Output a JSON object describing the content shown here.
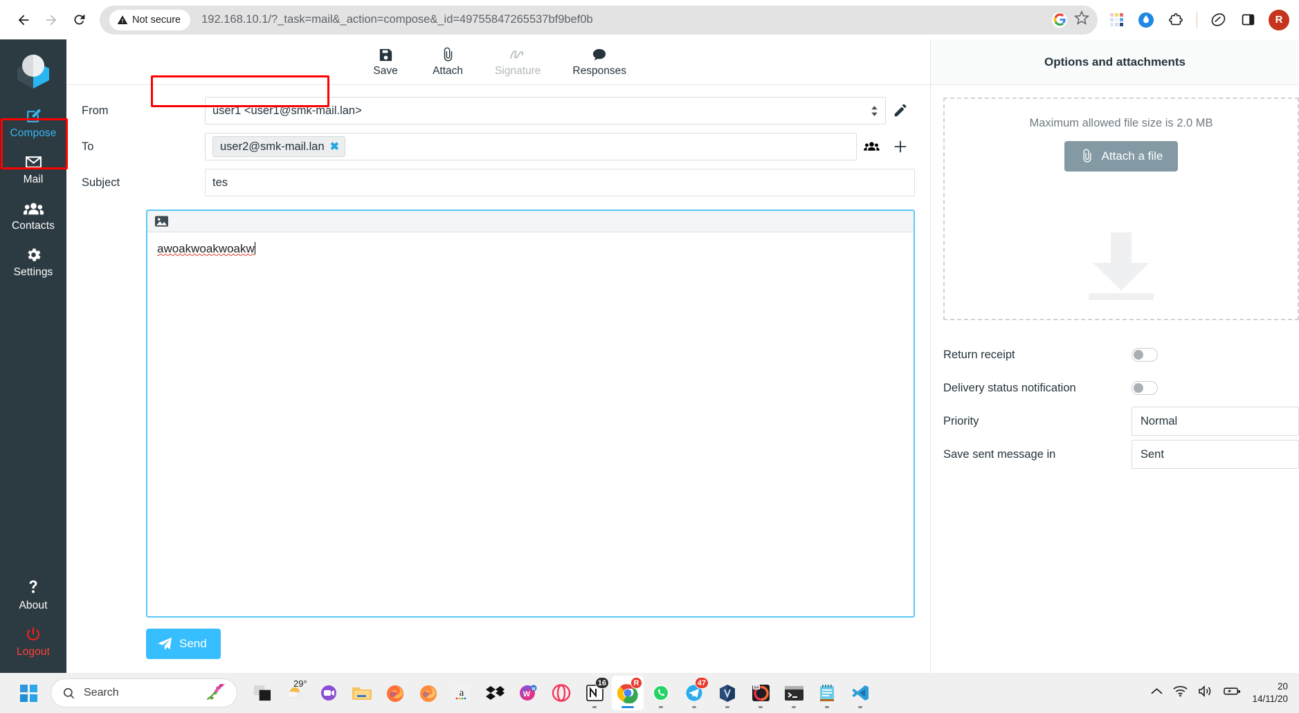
{
  "browser": {
    "back_label": "Back",
    "forward_label": "Forward",
    "reload_label": "Reload",
    "security_label": "Not secure",
    "url": "192.168.10.1/?_task=mail&_action=compose&_id=49755847265537bf9bef0b",
    "search_engine_icon": "google-g-icon",
    "bookmark_icon": "star-icon",
    "extensions": [
      "color-grid-extension-icon",
      "water-drop-extension-icon",
      "extensions-puzzle-icon",
      "leaf-extension-icon",
      "side-panel-icon"
    ],
    "profile_initial": "R"
  },
  "sidebar": {
    "logo": "roundcube-logo",
    "items": [
      {
        "label": "Compose",
        "icon": "compose-pencil-icon",
        "active": true
      },
      {
        "label": "Mail",
        "icon": "envelope-icon",
        "active": false
      },
      {
        "label": "Contacts",
        "icon": "people-icon",
        "active": false
      },
      {
        "label": "Settings",
        "icon": "gear-icon",
        "active": false
      }
    ],
    "bottom_items": [
      {
        "label": "About",
        "icon": "question-mark-icon"
      },
      {
        "label": "Logout",
        "icon": "power-icon"
      }
    ]
  },
  "toolbar": {
    "save": "Save",
    "attach": "Attach",
    "signature": "Signature",
    "responses": "Responses"
  },
  "compose": {
    "from_label": "From",
    "from_value": "user1 <user1@smk-mail.lan>",
    "to_label": "To",
    "to_chip": "user2@smk-mail.lan",
    "to_chip_remove": "✖",
    "subject_label": "Subject",
    "subject_value": "tes",
    "body_text": "awoakwoakwoakw",
    "send_label": "Send",
    "edit_identity_icon": "pencil-icon",
    "contacts_icon": "address-book-icon",
    "add_recipient_icon": "plus-icon",
    "insert_image_icon": "image-icon"
  },
  "options": {
    "title": "Options and attachments",
    "max_size_note": "Maximum allowed file size is 2.0 MB",
    "attach_button": "Attach a file",
    "rows": [
      {
        "label": "Return receipt",
        "type": "toggle",
        "value": "off"
      },
      {
        "label": "Delivery status notification",
        "type": "toggle",
        "value": "off"
      },
      {
        "label": "Priority",
        "type": "select",
        "value": "Normal"
      },
      {
        "label": "Save sent message in",
        "type": "select",
        "value": "Sent"
      }
    ]
  },
  "taskbar": {
    "start_label": "Start",
    "search_placeholder": "Search",
    "weather_temp": "29°",
    "apps": [
      {
        "name": "task-view",
        "badge": "",
        "active": false
      },
      {
        "name": "weather",
        "badge": "",
        "active": false
      },
      {
        "name": "teams",
        "badge": "",
        "active": false
      },
      {
        "name": "file-explorer",
        "badge": "",
        "active": false
      },
      {
        "name": "firefox",
        "badge": "",
        "active": false
      },
      {
        "name": "firefox-dev",
        "badge": "",
        "active": false
      },
      {
        "name": "amazon",
        "badge": "",
        "active": false
      },
      {
        "name": "dropbox",
        "badge": "",
        "active": false
      },
      {
        "name": "wondershare",
        "badge": "",
        "active": false
      },
      {
        "name": "opera-gx",
        "badge": "",
        "active": false
      },
      {
        "name": "notion",
        "badge": "16",
        "active": false
      },
      {
        "name": "chrome",
        "badge": "R",
        "active": true
      },
      {
        "name": "whatsapp",
        "badge": "",
        "active": false
      },
      {
        "name": "telegram",
        "badge": "47",
        "active": false
      },
      {
        "name": "virtualbox",
        "badge": "",
        "active": false
      },
      {
        "name": "camtasia",
        "badge": "64",
        "active": false
      },
      {
        "name": "terminal",
        "badge": "",
        "active": false
      },
      {
        "name": "notepad",
        "badge": "",
        "active": false
      },
      {
        "name": "vscode",
        "badge": "",
        "active": false
      }
    ],
    "clock_time": "20",
    "clock_date": "14/11/20"
  }
}
